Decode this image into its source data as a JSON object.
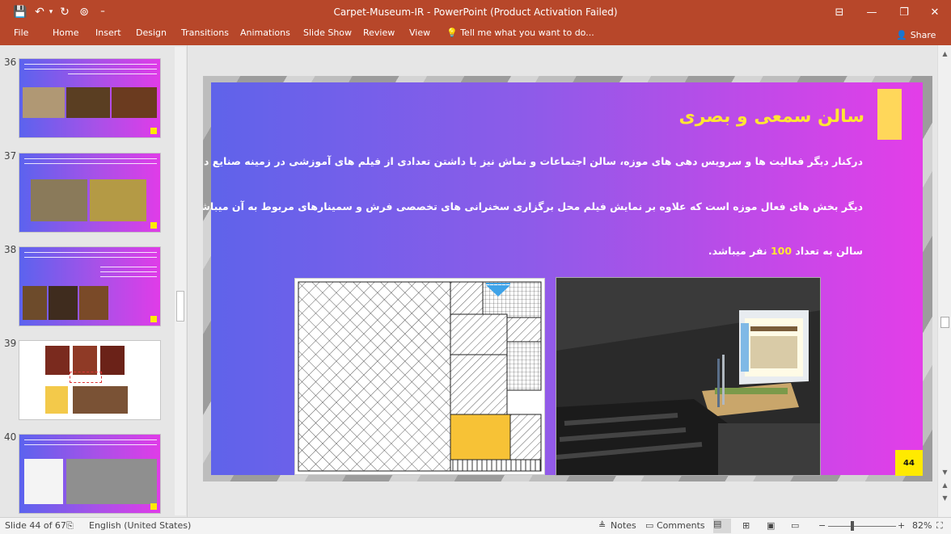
{
  "window": {
    "title": "Carpet-Museum-IR - PowerPoint (Product Activation Failed)",
    "controls": {
      "restore": "❐",
      "minimize": "—",
      "maximize": "▢",
      "close": "✕",
      "ribbon_display": "⊟"
    }
  },
  "qat": {
    "save": "💾",
    "undo": "↶",
    "undo_dd": "▾",
    "redo": "↻",
    "present": "⊚",
    "customize": "⁼"
  },
  "ribbon": {
    "tabs": [
      "File",
      "Home",
      "Insert",
      "Design",
      "Transitions",
      "Animations",
      "Slide Show",
      "Review",
      "View"
    ],
    "tell_me": "Tell me what you want to do...",
    "share": "Share"
  },
  "thumbnails": [
    {
      "number": "36"
    },
    {
      "number": "37"
    },
    {
      "number": "38"
    },
    {
      "number": "39"
    },
    {
      "number": "40"
    }
  ],
  "slide": {
    "title": "سالن سمعی و بصری",
    "body_lines": [
      "درکنار دیگر فعالیت ها و سرویس دهی های موزه، سالن اجتماعات و نماش نیز با داشتن تعدادی از فیلم های آموزشی در زمینه صنایع دستی مختلف از",
      "دیگر بخش های فعال موزه است که علاوه بر نمایش فیلم محل برگزاری سخنرانی های تخصصی فرش و سمینارهای مربوط به آن میباشد. گنجایش این"
    ],
    "last_line_before": "سالن به تعداد ",
    "highlight_number": "100",
    "last_line_after": " نفر میباشد.",
    "page_number": "44",
    "colors": {
      "panel_start": "#5f63ea",
      "panel_end": "#e33ee8",
      "title": "#ffe633",
      "badge": "#ffea00"
    }
  },
  "statusbar": {
    "slide_info": "Slide 44 of 67",
    "language": "English (United States)",
    "notes": "Notes",
    "comments": "Comments",
    "zoom": "82%"
  },
  "accent_color": "#b7472a"
}
